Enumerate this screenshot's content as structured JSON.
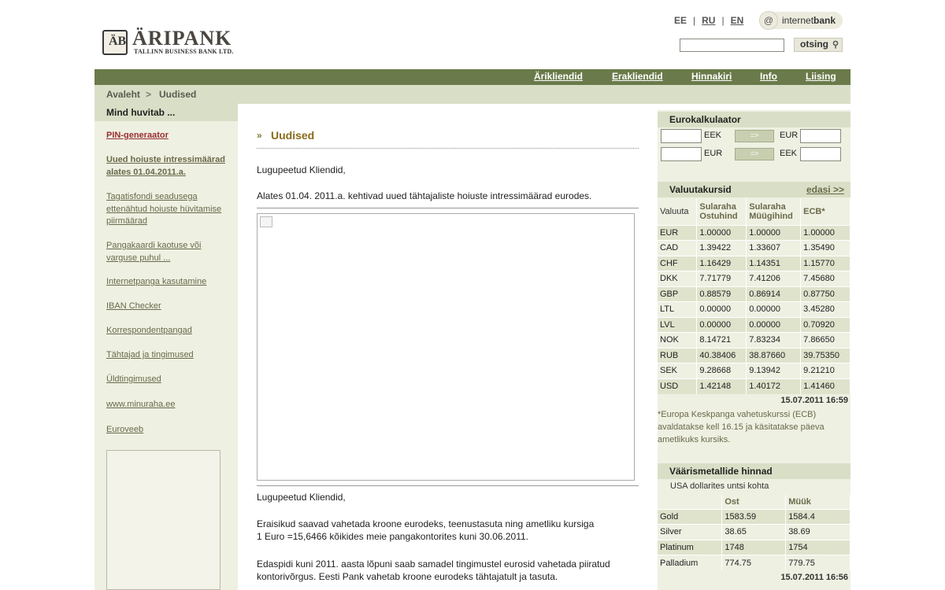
{
  "header": {
    "logo_mark": "ÄB",
    "logo_name": "ÄRIPANK",
    "logo_sub": "TALLINN BUSINESS BANK LTD.",
    "lang": [
      "EE",
      "RU",
      "EN"
    ],
    "internetbank_prefix": "internet",
    "internetbank_bold": "bank",
    "search_placeholder": "",
    "search_button": "otsing"
  },
  "nav": [
    "Ärikliendid",
    "Erakliendid",
    "Hinnakiri",
    "Info",
    "Liising"
  ],
  "breadcrumb": {
    "home": "Avaleht",
    "sep": ">",
    "current": "Uudised"
  },
  "sidebar": {
    "title": "Mind huvitab ...",
    "items": [
      "PIN-generaator",
      "Uued hoiuste intressimäärad alates 01.04.2011.a.",
      "Tagatisfondi seadusega ettenähtud hoiuste hüvitamise piirmäärad",
      "Pangakaardi kaotuse või varguse puhul ...",
      "Internetpanga kasutamine",
      "IBAN Checker",
      "Korrespondentpangad",
      "Tähtajad ja tingimused",
      "Üldtingimused",
      "www.minuraha.ee",
      "Euroveeb"
    ]
  },
  "main": {
    "title": "Uudised",
    "p1": "Lugupeetud Kliendid,",
    "p2": "Alates 01.04. 2011.a. kehtivad uued tähtajaliste hoiuste intressimäärad eurodes.",
    "p3": "Lugupeetud Kliendid,",
    "p4a": "Eraisikud saavad vahetada kroone eurodeks, teenustasuta ning ametliku kursiga",
    "p4b": "1 Euro =15,6466 kõikides meie pangakontorites kuni 30.06.2011.",
    "p5a": "Edaspidi kuni 2011. aasta lõpuni saab samadel tingimustel eurosid vahetada piiratud",
    "p5b": "kontorivõrgus. Eesti Pank vahetab kroone eurodeks tähtajatult ja tasuta."
  },
  "calc": {
    "title": "Eurokalkulaator",
    "row1_from": "EEK",
    "row1_to": "EUR",
    "row2_from": "EUR",
    "row2_to": "EEK",
    "btn": "=>"
  },
  "fx": {
    "title": "Valuutakursid",
    "more": "edasi >>",
    "headers": [
      "Valuuta",
      "Sularaha Ostuhind",
      "Sularaha Müügihind",
      "ECB*"
    ],
    "rows": [
      [
        "EUR",
        "1.00000",
        "1.00000",
        "1.00000"
      ],
      [
        "CAD",
        "1.39422",
        "1.33607",
        "1.35490"
      ],
      [
        "CHF",
        "1.16429",
        "1.14351",
        "1.15770"
      ],
      [
        "DKK",
        "7.71779",
        "7.41206",
        "7.45680"
      ],
      [
        "GBP",
        "0.88579",
        "0.86914",
        "0.87750"
      ],
      [
        "LTL",
        "0.00000",
        "0.00000",
        "3.45280"
      ],
      [
        "LVL",
        "0.00000",
        "0.00000",
        "0.70920"
      ],
      [
        "NOK",
        "8.14721",
        "7.83234",
        "7.86650"
      ],
      [
        "RUB",
        "40.38406",
        "38.87660",
        "39.75350"
      ],
      [
        "SEK",
        "9.28668",
        "9.13942",
        "9.21210"
      ],
      [
        "USD",
        "1.42148",
        "1.40172",
        "1.41460"
      ]
    ],
    "timestamp": "15.07.2011 16:59",
    "note": "*Europa Keskpanga vahetuskurssi (ECB) avaldatakse kell 16.15 ja käsitatakse päeva ametlikuks kursiks."
  },
  "metals": {
    "title": "Väärismetallide hinnad",
    "subtitle": "USA dollarites untsi kohta",
    "headers": [
      "",
      "Ost",
      "Müük"
    ],
    "rows": [
      [
        "Gold",
        "1583.59",
        "1584.4"
      ],
      [
        "Silver",
        "38.65",
        "38.69"
      ],
      [
        "Platinum",
        "1748",
        "1754"
      ],
      [
        "Palladium",
        "774.75",
        "779.75"
      ]
    ],
    "timestamp": "15.07.2011 16:56"
  }
}
